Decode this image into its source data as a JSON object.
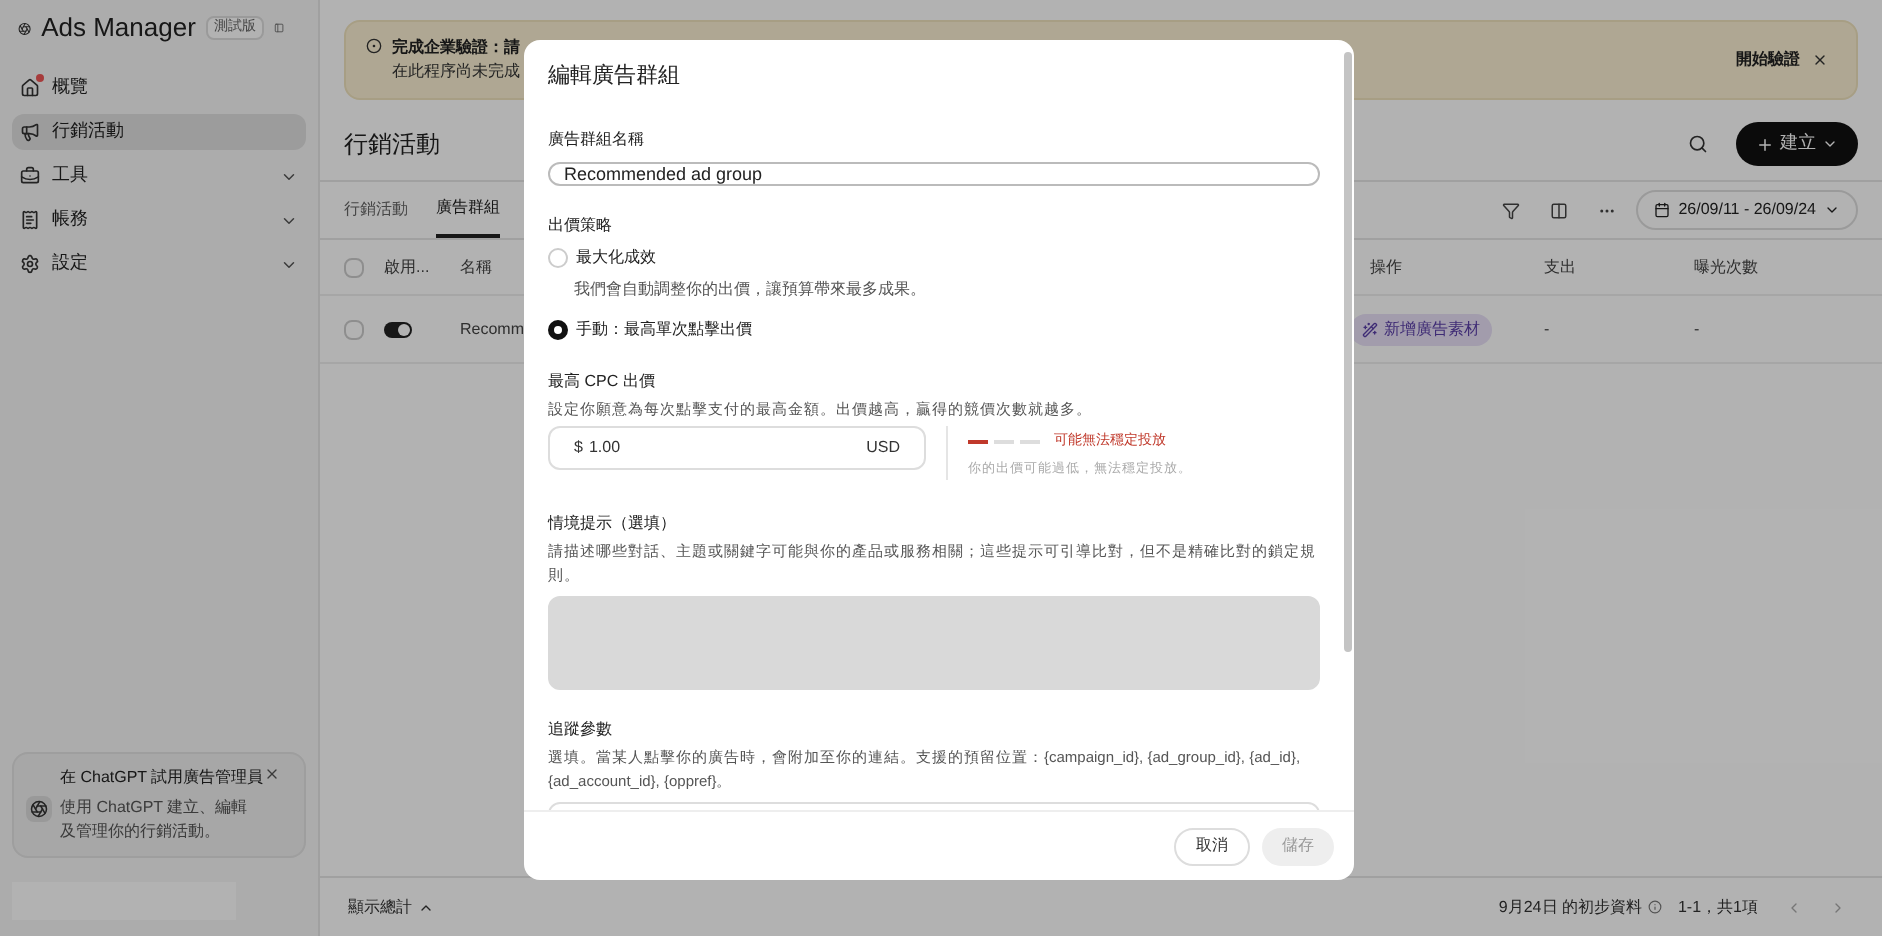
{
  "sidebar": {
    "brand": "Ads Manager",
    "badge": "測試版",
    "items": [
      {
        "label": "概覽",
        "selected": false,
        "expandable": false,
        "notification": true
      },
      {
        "label": "行銷活動",
        "selected": true,
        "expandable": false,
        "notification": false
      },
      {
        "label": "工具",
        "selected": false,
        "expandable": true,
        "notification": false
      },
      {
        "label": "帳務",
        "selected": false,
        "expandable": true,
        "notification": false
      },
      {
        "label": "設定",
        "selected": false,
        "expandable": true,
        "notification": false
      }
    ],
    "promo": {
      "title": "在 ChatGPT 試用廣告管理員",
      "text": "使用 ChatGPT 建立、編輯及管理你的行銷活動。"
    }
  },
  "banner": {
    "title": "完成企業驗證：請",
    "text": "在此程序尚未完成",
    "action": "開始驗證"
  },
  "page": {
    "title": "行銷活動",
    "create_button": "建立"
  },
  "tabs": [
    {
      "label": "行銷活動",
      "selected": false
    },
    {
      "label": "廣告群組",
      "selected": true
    }
  ],
  "toolbar": {
    "date_range": "26/09/11 - 26/09/24"
  },
  "table": {
    "select_all_checked": false,
    "columns": [
      "啟用...",
      "名稱",
      "操作",
      "支出",
      "曝光次數"
    ],
    "rows": [
      {
        "checked": false,
        "enabled": true,
        "name": "Recomm",
        "action": "新增廣告素材",
        "spend": "-",
        "impressions": "-"
      }
    ]
  },
  "footer": {
    "totals_toggle": "顯示總計",
    "data_note": "9月24日 的初步資料",
    "range": "1-1，共1項"
  },
  "modal": {
    "title": "編輯廣告群組",
    "name_label": "廣告群組名稱",
    "name_value": "Recommended ad group",
    "bid_label": "出價策略",
    "bid_options": [
      {
        "label": "最大化成效",
        "description": "我們會自動調整你的出價，讓預算帶來最多成果。",
        "selected": false
      },
      {
        "label": "手動：最高單次點擊出價",
        "selected": true
      }
    ],
    "cpc_label": "最高 CPC 出價",
    "cpc_description": "設定你願意為每次點擊支付的最高金額。出價越高，贏得的競價次數就越多。",
    "cpc_currency_symbol": "$",
    "cpc_value": "1.00",
    "cpc_currency": "USD",
    "bid_strength": {
      "level": 0.33,
      "status": "可能無法穩定投放",
      "note": "你的出價可能過低，無法穩定投放。"
    },
    "context_label": "情境提示（選填）",
    "context_description": "請描述哪些對話、主題或關鍵字可能與你的產品或服務相關；這些提示可引導比對，但不是精確比對的鎖定規則。",
    "context_disabled": true,
    "tracking_label": "追蹤參數",
    "tracking_description": "選填。當某人點擊你的廣告時，會附加至你的連結。支援的預留位置：{campaign_id}, {ad_group_id}, {ad_id}, {ad_account_id}, {oppref}。",
    "cancel": "取消",
    "save": "儲存",
    "save_disabled": true
  }
}
